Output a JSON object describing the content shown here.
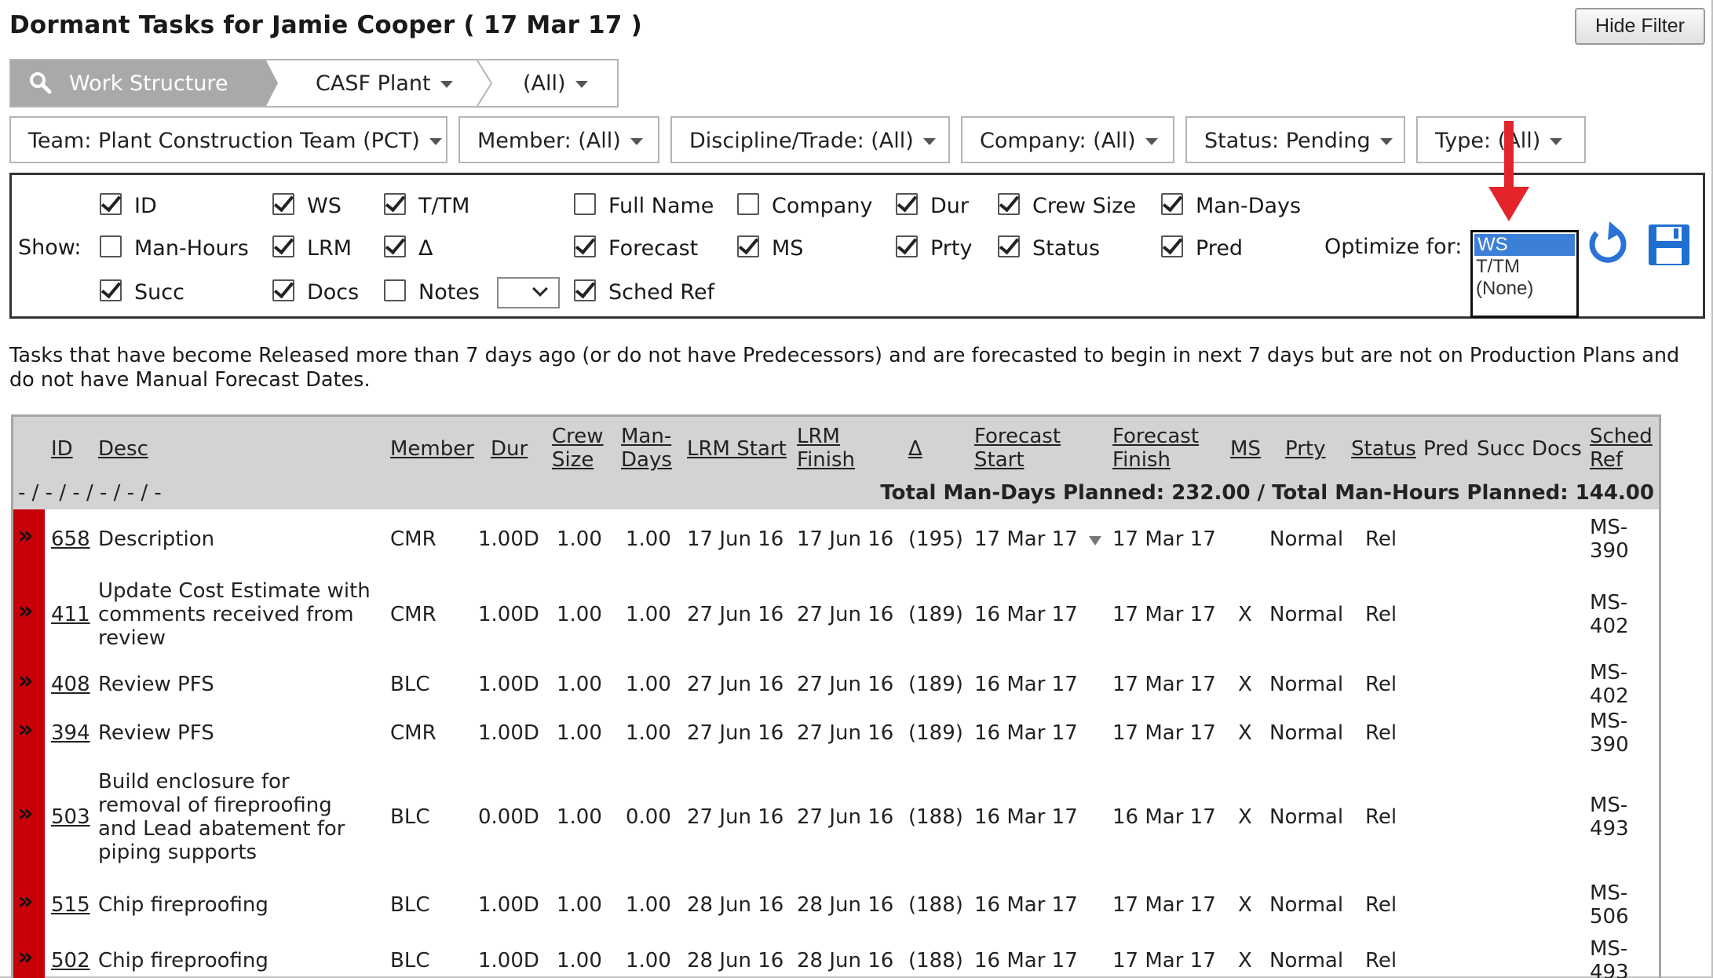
{
  "title": "Dormant Tasks for Jamie Cooper ( 17 Mar 17 )",
  "hide_filter": "Hide Filter",
  "breadcrumb": {
    "work_structure": "Work Structure",
    "plant": "CASF Plant",
    "all": "(All)"
  },
  "filters": {
    "team": "Team: Plant Construction Team (PCT)",
    "member": "Member: (All)",
    "discipline": "Discipline/Trade: (All)",
    "company": "Company: (All)",
    "status": "Status: Pending",
    "type": "Type: (All)"
  },
  "show": {
    "label": "Show:",
    "id": "ID",
    "ws": "WS",
    "ttm": "T/TM",
    "full_name": "Full Name",
    "company": "Company",
    "dur": "Dur",
    "crew_size": "Crew Size",
    "man_days": "Man-Days",
    "man_hours": "Man-Hours",
    "lrm": "LRM",
    "delta": "Δ",
    "forecast": "Forecast",
    "ms": "MS",
    "prty": "Prty",
    "status": "Status",
    "pred": "Pred",
    "succ": "Succ",
    "docs": "Docs",
    "notes": "Notes",
    "sched_ref": "Sched Ref"
  },
  "optimize": {
    "label": "Optimize for:",
    "options": [
      "WS",
      "T/TM",
      "(None)"
    ],
    "selected": "WS"
  },
  "description": "Tasks that have become Released more than 7 days ago (or do not have Predecessors) and are forecasted to begin in next 7 days but are not on Production Plans and do not have Manual Forecast Dates.",
  "grid": {
    "headers": {
      "id": "ID",
      "desc": "Desc",
      "member": "Member",
      "dur": "Dur",
      "crew1": "Crew",
      "crew2": "Size",
      "man1": "Man-",
      "man2": "Days",
      "lrm_start": "LRM Start",
      "lrm_fin1": "LRM",
      "lrm_fin2": "Finish",
      "delta": "Δ",
      "fs1": "Forecast",
      "fs2": "Start",
      "ff1": "Forecast",
      "ff2": "Finish",
      "ms": "MS",
      "prty": "Prty",
      "status": "Status",
      "pred": "Pred",
      "succ": "Succ",
      "docs": "Docs",
      "sref1": "Sched",
      "sref2": "Ref"
    },
    "pager": "- / - / - / - / - / -",
    "totals": "Total Man-Days Planned: 232.00 / Total Man-Hours Planned: 144.00",
    "rows": [
      {
        "id": "658",
        "desc": "Description",
        "member": "CMR",
        "dur": "1.00D",
        "crew": "1.00",
        "mandays": "1.00",
        "lrm_start": "17 Jun 16",
        "lrm_finish": "17 Jun 16",
        "delta": "(195)",
        "fstart": "17 Mar 17",
        "ffinish": "17 Mar 17",
        "ms": "",
        "prty": "Normal",
        "status": "Rel",
        "sref1": "MS-",
        "sref2": "390"
      },
      {
        "id": "411",
        "desc": "Update Cost Estimate with comments received from review",
        "member": "CMR",
        "dur": "1.00D",
        "crew": "1.00",
        "mandays": "1.00",
        "lrm_start": "27 Jun 16",
        "lrm_finish": "27 Jun 16",
        "delta": "(189)",
        "fstart": "16 Mar 17",
        "ffinish": "17 Mar 17",
        "ms": "X",
        "prty": "Normal",
        "status": "Rel",
        "sref1": "MS-",
        "sref2": "402"
      },
      {
        "id": "408",
        "desc": "Review PFS",
        "member": "BLC",
        "dur": "1.00D",
        "crew": "1.00",
        "mandays": "1.00",
        "lrm_start": "27 Jun 16",
        "lrm_finish": "27 Jun 16",
        "delta": "(189)",
        "fstart": "16 Mar 17",
        "ffinish": "17 Mar 17",
        "ms": "X",
        "prty": "Normal",
        "status": "Rel",
        "sref1": "MS-",
        "sref2": "402"
      },
      {
        "id": "394",
        "desc": "Review PFS",
        "member": "CMR",
        "dur": "1.00D",
        "crew": "1.00",
        "mandays": "1.00",
        "lrm_start": "27 Jun 16",
        "lrm_finish": "27 Jun 16",
        "delta": "(189)",
        "fstart": "16 Mar 17",
        "ffinish": "17 Mar 17",
        "ms": "X",
        "prty": "Normal",
        "status": "Rel",
        "sref1": "MS-",
        "sref2": "390"
      },
      {
        "id": "503",
        "desc": "Build enclosure for removal of fireproofing and Lead abatement for piping supports",
        "member": "BLC",
        "dur": "0.00D",
        "crew": "1.00",
        "mandays": "0.00",
        "lrm_start": "27 Jun 16",
        "lrm_finish": "27 Jun 16",
        "delta": "(188)",
        "fstart": "16 Mar 17",
        "ffinish": "16 Mar 17",
        "ms": "X",
        "prty": "Normal",
        "status": "Rel",
        "sref1": "MS-",
        "sref2": "493"
      },
      {
        "id": "515",
        "desc": "Chip fireproofing",
        "member": "BLC",
        "dur": "1.00D",
        "crew": "1.00",
        "mandays": "1.00",
        "lrm_start": "28 Jun 16",
        "lrm_finish": "28 Jun 16",
        "delta": "(188)",
        "fstart": "16 Mar 17",
        "ffinish": "17 Mar 17",
        "ms": "X",
        "prty": "Normal",
        "status": "Rel",
        "sref1": "MS-",
        "sref2": "506"
      },
      {
        "id": "502",
        "desc": "Chip fireproofing",
        "member": "BLC",
        "dur": "1.00D",
        "crew": "1.00",
        "mandays": "1.00",
        "lrm_start": "28 Jun 16",
        "lrm_finish": "28 Jun 16",
        "delta": "(188)",
        "fstart": "16 Mar 17",
        "ffinish": "17 Mar 17",
        "ms": "X",
        "prty": "Normal",
        "status": "Rel",
        "sref1": "MS-",
        "sref2": "493"
      }
    ]
  }
}
